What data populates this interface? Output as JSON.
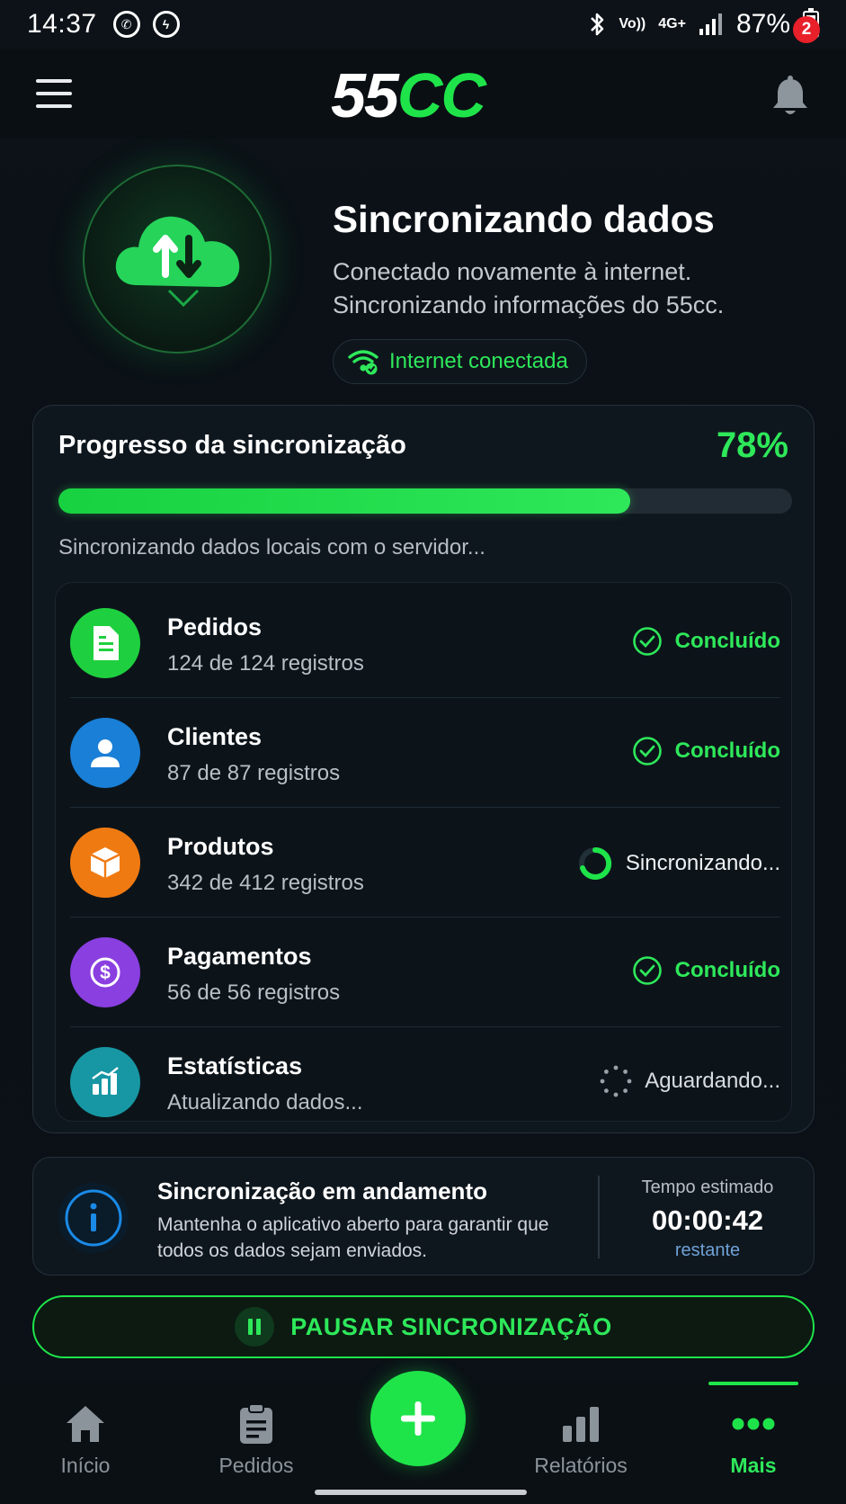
{
  "status_bar": {
    "time": "14:37",
    "network_top": "Vo))",
    "network_type": "4G+",
    "battery": "87%"
  },
  "header": {
    "logo_left": "55",
    "logo_right": "CC",
    "notification_count": "2"
  },
  "hero": {
    "title": "Sincronizando dados",
    "subtitle": "Conectado novamente à internet. Sincronizando informações do 55cc.",
    "connection_label": "Internet conectada"
  },
  "progress": {
    "title": "Progresso da sincronização",
    "percent_label": "78%",
    "percent_value": 0.78,
    "message": "Sincronizando dados locais com o servidor..."
  },
  "sync_items": [
    {
      "name": "Pedidos",
      "count": "124 de 124 registros",
      "status": "Concluído",
      "state": "done",
      "icon": "document-icon",
      "color": "#1ed03f"
    },
    {
      "name": "Clientes",
      "count": "87 de 87 registros",
      "status": "Concluído",
      "state": "done",
      "icon": "user-icon",
      "color": "#1a7fd6"
    },
    {
      "name": "Produtos",
      "count": "342 de 412 registros",
      "status": "Sincronizando...",
      "state": "sync",
      "icon": "box-icon",
      "color": "#f07a12"
    },
    {
      "name": "Pagamentos",
      "count": "56 de 56 registros",
      "status": "Concluído",
      "state": "done",
      "icon": "dollar-icon",
      "color": "#8a3fe0"
    },
    {
      "name": "Estatísticas",
      "count": "Atualizando dados...",
      "status": "Aguardando...",
      "state": "wait",
      "icon": "chart-icon",
      "color": "#1797a3"
    }
  ],
  "info": {
    "title": "Sincronização em andamento",
    "text": "Mantenha o aplicativo aberto para garantir que todos os dados sejam enviados.",
    "eta_label": "Tempo estimado",
    "eta_value": "00:00:42",
    "eta_sub": "restante"
  },
  "pause_button": {
    "label": "PAUSAR SINCRONIZAÇÃO"
  },
  "bottom_nav": {
    "items": [
      {
        "label": "Início",
        "icon": "home-icon"
      },
      {
        "label": "Pedidos",
        "icon": "clipboard-icon"
      },
      {
        "label": "Relatórios",
        "icon": "bar-chart-icon"
      },
      {
        "label": "Mais",
        "icon": "more-dots-icon",
        "active": true
      }
    ],
    "fab_icon": "plus-icon"
  },
  "colors": {
    "accent": "#1ee44a",
    "background": "#0b1117",
    "card": "#0f171e",
    "badge": "#e8202a"
  }
}
